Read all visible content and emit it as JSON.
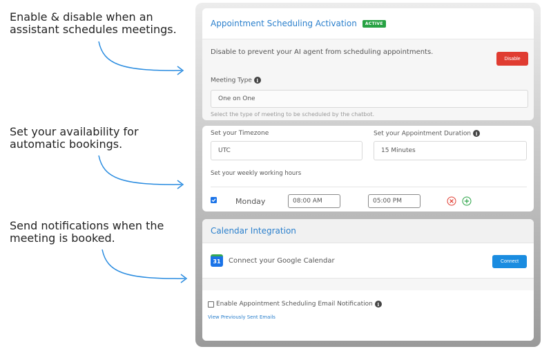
{
  "annotations": [
    "Enable & disable when an assistant schedules meetings.",
    "Set your availability for automatic bookings.",
    "Send notifications when the meeting is booked."
  ],
  "activation": {
    "title": "Appointment Scheduling Activation",
    "badge": "ACTIVE",
    "description": "Disable to prevent your AI agent from scheduling appointments.",
    "disable_label": "Disable",
    "meeting_type_label": "Meeting Type",
    "meeting_type_value": "One on One",
    "meeting_type_helper": "Select the type of meeting to be scheduled by the chatbot."
  },
  "availability": {
    "timezone_label": "Set your Timezone",
    "timezone_value": "UTC",
    "duration_label": "Set your Appointment Duration",
    "duration_value": "15 Minutes",
    "weekly_label": "Set your weekly working hours",
    "day": "Monday",
    "start_time": "08:00 AM",
    "end_time": "05:00 PM"
  },
  "calendar": {
    "title": "Calendar Integration",
    "google_label": "Connect your Google Calendar",
    "connect_label": "Connect",
    "google_icon_text": "31",
    "email_notification_label": "Enable Appointment Scheduling Email Notification",
    "view_sent_link": "View Previously Sent Emails"
  },
  "colors": {
    "accent": "#2a7fcc",
    "active_badge": "#27a243",
    "disable_button": "#e03c31",
    "connect_button": "#1a8ce0"
  }
}
